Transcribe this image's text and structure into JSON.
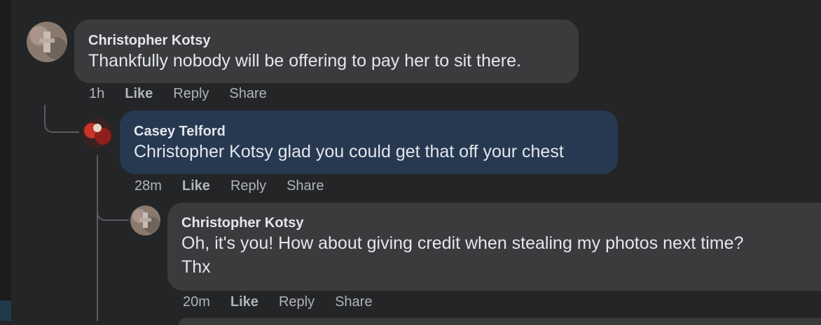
{
  "comments": [
    {
      "author": "Christopher Kotsy",
      "text": "Thankfully nobody will be offering to pay her to sit there.",
      "time": "1h",
      "like": "Like",
      "reply": "Reply",
      "share": "Share",
      "bubble_color": "#3a3b3c"
    },
    {
      "author": "Casey Telford",
      "text": "Christopher Kotsy glad you could get that off your chest",
      "time": "28m",
      "like": "Like",
      "reply": "Reply",
      "share": "Share",
      "bubble_color": "#263951"
    },
    {
      "author": "Christopher Kotsy",
      "text_line1": "Oh, it's you! How about giving credit when stealing my photos next time?",
      "text_line2": "Thx",
      "time": "20m",
      "like": "Like",
      "reply": "Reply",
      "share": "Share",
      "bubble_color": "#3a3b3c"
    }
  ],
  "colors": {
    "background": "#242526",
    "text_primary": "#e4e6eb",
    "text_secondary": "#b0b3b8",
    "thread_line": "#5a5c5f"
  }
}
